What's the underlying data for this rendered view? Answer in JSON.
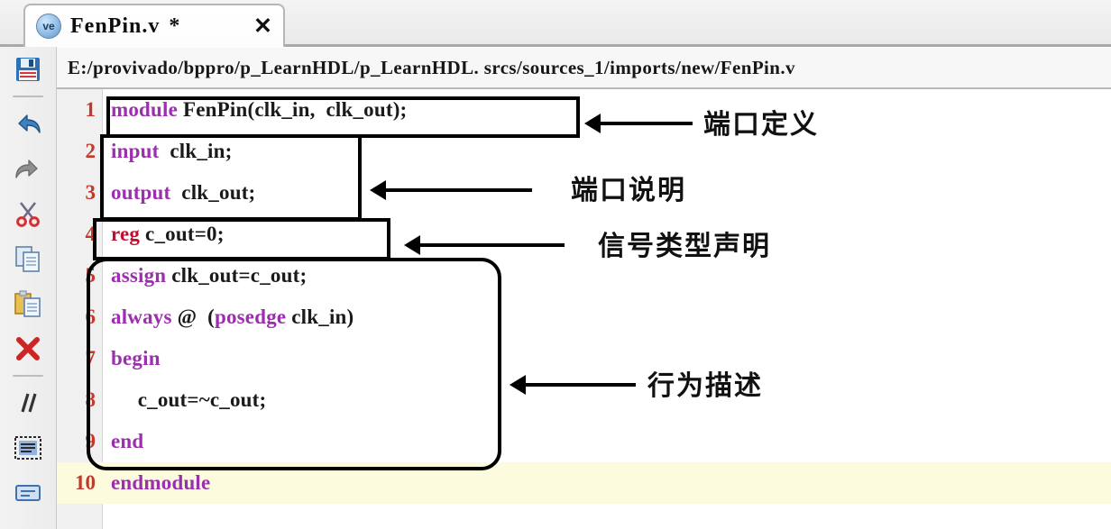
{
  "window": {
    "tab": {
      "icon": "verilog-file-icon",
      "icon_text": "ve",
      "title": "FenPin.v",
      "dirty_marker": "*",
      "close_label": "✕"
    }
  },
  "toolbar": {
    "items": [
      {
        "name": "save-icon",
        "label": "Save"
      },
      {
        "name": "separator",
        "label": ""
      },
      {
        "name": "undo-icon",
        "label": "Undo"
      },
      {
        "name": "redo-icon",
        "label": "Redo"
      },
      {
        "name": "cut-icon",
        "label": "Cut"
      },
      {
        "name": "copy-icon",
        "label": "Copy"
      },
      {
        "name": "paste-icon",
        "label": "Paste"
      },
      {
        "name": "delete-icon",
        "label": "Delete"
      },
      {
        "name": "separator",
        "label": ""
      },
      {
        "name": "comment-icon",
        "label": "Toggle Comment"
      },
      {
        "name": "find-replace-icon",
        "label": "Find / Replace"
      },
      {
        "name": "wrap-icon",
        "label": "Word Wrap"
      }
    ]
  },
  "pathbar": {
    "path": "E:/provivado/bppro/p_LearnHDL/p_LearnHDL. srcs/sources_1/imports/new/FenPin.v"
  },
  "editor": {
    "lines": [
      {
        "number": "1",
        "segments": [
          {
            "t": "module",
            "c": "kw"
          },
          {
            "t": " FenPin(clk_in,  clk_out);",
            "c": ""
          }
        ],
        "highlight": false
      },
      {
        "number": "2",
        "segments": [
          {
            "t": "input",
            "c": "kw"
          },
          {
            "t": "  clk_in;",
            "c": ""
          }
        ],
        "highlight": false
      },
      {
        "number": "3",
        "segments": [
          {
            "t": "output",
            "c": "kw"
          },
          {
            "t": "  clk_out;",
            "c": ""
          }
        ],
        "highlight": false
      },
      {
        "number": "4",
        "segments": [
          {
            "t": "reg",
            "c": "kw-reg"
          },
          {
            "t": " c_out=0;",
            "c": ""
          }
        ],
        "highlight": false
      },
      {
        "number": "5",
        "segments": [
          {
            "t": "assign",
            "c": "kw"
          },
          {
            "t": " clk_out=c_out;",
            "c": ""
          }
        ],
        "highlight": false
      },
      {
        "number": "6",
        "segments": [
          {
            "t": "always",
            "c": "kw"
          },
          {
            "t": " @  (",
            "c": ""
          },
          {
            "t": "posedge",
            "c": "kw"
          },
          {
            "t": " clk_in)",
            "c": ""
          }
        ],
        "highlight": false
      },
      {
        "number": "7",
        "segments": [
          {
            "t": "begin",
            "c": "kw"
          }
        ],
        "highlight": false
      },
      {
        "number": "8",
        "segments": [
          {
            "t": "     c_out=~c_out;",
            "c": ""
          }
        ],
        "highlight": false
      },
      {
        "number": "9",
        "segments": [
          {
            "t": "end",
            "c": "kw"
          }
        ],
        "highlight": false
      },
      {
        "number": "10",
        "segments": [
          {
            "t": "endmodule",
            "c": "kw"
          }
        ],
        "highlight": true
      }
    ]
  },
  "annotations": [
    {
      "name": "annotation-port-definition",
      "label": "端口定义"
    },
    {
      "name": "annotation-port-declaration",
      "label": "端口说明"
    },
    {
      "name": "annotation-signal-type",
      "label": "信号类型声明"
    },
    {
      "name": "annotation-behavioral",
      "label": "行为描述"
    }
  ],
  "colors": {
    "keyword": "#9b2fae",
    "reg_keyword": "#c01030",
    "line_number": "#c0392b",
    "current_line_highlight": "#fcfbdd",
    "annotation_stroke": "#000000"
  }
}
